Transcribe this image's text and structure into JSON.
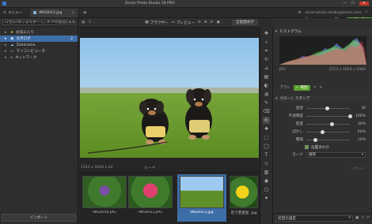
{
  "app": {
    "title": "Zoner Photo Studio 18 PRO",
    "menu_label": "メニュー"
  },
  "window_controls": {
    "minimize": "—",
    "maximize": "☐",
    "close": "✕"
  },
  "tabs": [
    {
      "label": "IMG0013.jpg",
      "close": "×"
    }
  ],
  "new_tab": "+",
  "header_right": {
    "account": "zoner.photo.studio@zoner.com"
  },
  "modes": {
    "manager": "マネージャー",
    "preview": "閲覧",
    "editor": "エディター"
  },
  "left": {
    "path": "ロカロ7のフォルダー (二-X-ドの名前)",
    "tree": [
      {
        "label": "お気に入り"
      },
      {
        "label": "カタログ",
        "count": "2"
      },
      {
        "label": "Zonerama"
      },
      {
        "label": "マイコンピュータ"
      },
      {
        "label": "ネットワーク"
      }
    ],
    "import_label": "インポート"
  },
  "toolbar": {
    "browser": "ブラウザー",
    "preview": "プレビュー",
    "zoom": "全画面表示"
  },
  "status": {
    "dims": "1513 x 1024 x 24",
    "info": "ルーペ"
  },
  "filmstrip": [
    {
      "caption": "IMG0016.JPG"
    },
    {
      "caption": "IMG0011.JPG"
    },
    {
      "caption": "IMG0013.jpg"
    },
    {
      "caption": "花で若者屋 .jpg"
    }
  ],
  "right": {
    "histogram_title": "ヒストグラム",
    "file_type": "JPG",
    "file_dims": "1513 x 1024 x 24bit",
    "brush_label": "ブラシ",
    "brush_button": "範囲",
    "clone_title": "クローン スタンプ",
    "sliders": [
      {
        "label": "直径",
        "value": "30",
        "pos": 0.48
      },
      {
        "label": "不透明度",
        "value": "100%",
        "pos": 1.0
      },
      {
        "label": "密度",
        "value": "30%",
        "pos": 0.58
      },
      {
        "label": "ぼかし",
        "value": "50%",
        "pos": 0.36
      },
      {
        "label": "間隔",
        "value": "10%",
        "pos": 0.2
      }
    ],
    "align_label": "位置あわせ",
    "mode_label": "モード",
    "mode_value": "通常",
    "reset_button": "リセット",
    "edit_button": "前回の設定"
  },
  "colors": {
    "accent_green": "#5aa22e",
    "selection_blue": "#3e6ea8"
  }
}
